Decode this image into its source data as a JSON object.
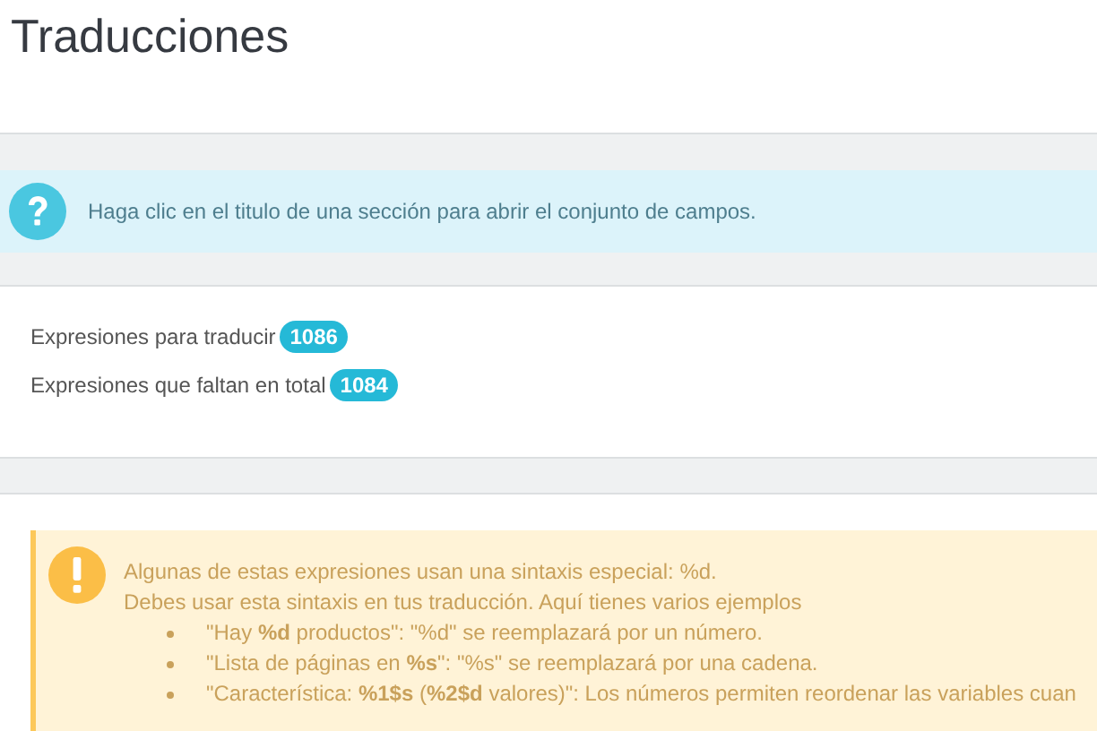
{
  "page_title": "Traducciones",
  "info_alert": {
    "text": "Haga clic en el titulo de una sección para abrir el conjunto de campos."
  },
  "stats": [
    {
      "label": "Expresiones para traducir",
      "count": "1086"
    },
    {
      "label": "Expresiones que faltan en total",
      "count": "1084"
    }
  ],
  "warning_alert": {
    "lines": [
      "Algunas de estas expresiones usan una sintaxis especial: %d.",
      "Debes usar esta sintaxis en tus traducción. Aquí tienes varios ejemplos"
    ],
    "examples": [
      "\"Hay **%d** productos\": \"%d\" se reemplazará por un número.",
      "\"Lista de páginas en **%s**\": \"%s\" se reemplazará por una cadena.",
      "\"Característica: **%1$s** (**%2$d** valores)\": Los números permiten reordenar las variables cuan"
    ]
  }
}
